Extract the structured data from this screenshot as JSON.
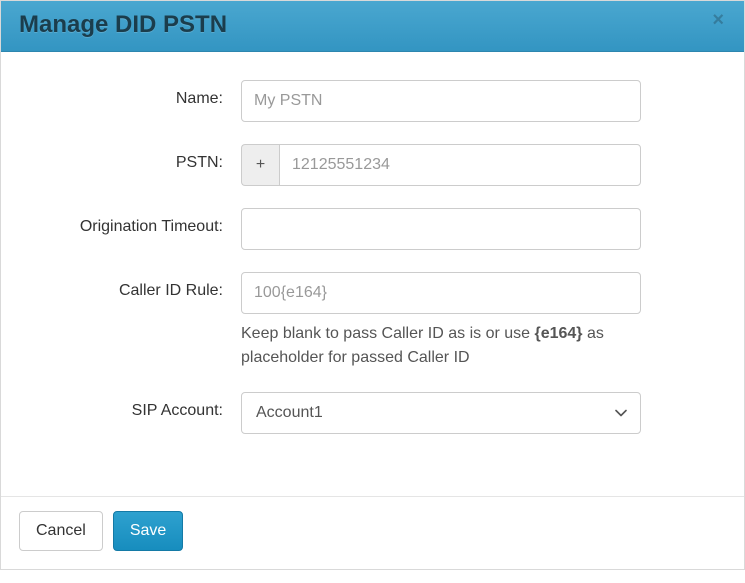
{
  "header": {
    "title": "Manage DID PSTN",
    "close_glyph": "×"
  },
  "form": {
    "name": {
      "label": "Name:",
      "placeholder": "My PSTN",
      "value": ""
    },
    "pstn": {
      "label": "PSTN:",
      "prefix": "+",
      "placeholder": "12125551234",
      "value": ""
    },
    "origination_timeout": {
      "label": "Origination Timeout:",
      "value": ""
    },
    "caller_id_rule": {
      "label": "Caller ID Rule:",
      "placeholder": "100{e164}",
      "value": "",
      "help_pre": "Keep blank to pass Caller ID as is or use ",
      "help_bold": "{e164}",
      "help_post": " as placeholder for passed Caller ID"
    },
    "sip_account": {
      "label": "SIP Account:",
      "selected": "Account1"
    }
  },
  "footer": {
    "cancel": "Cancel",
    "save": "Save"
  }
}
